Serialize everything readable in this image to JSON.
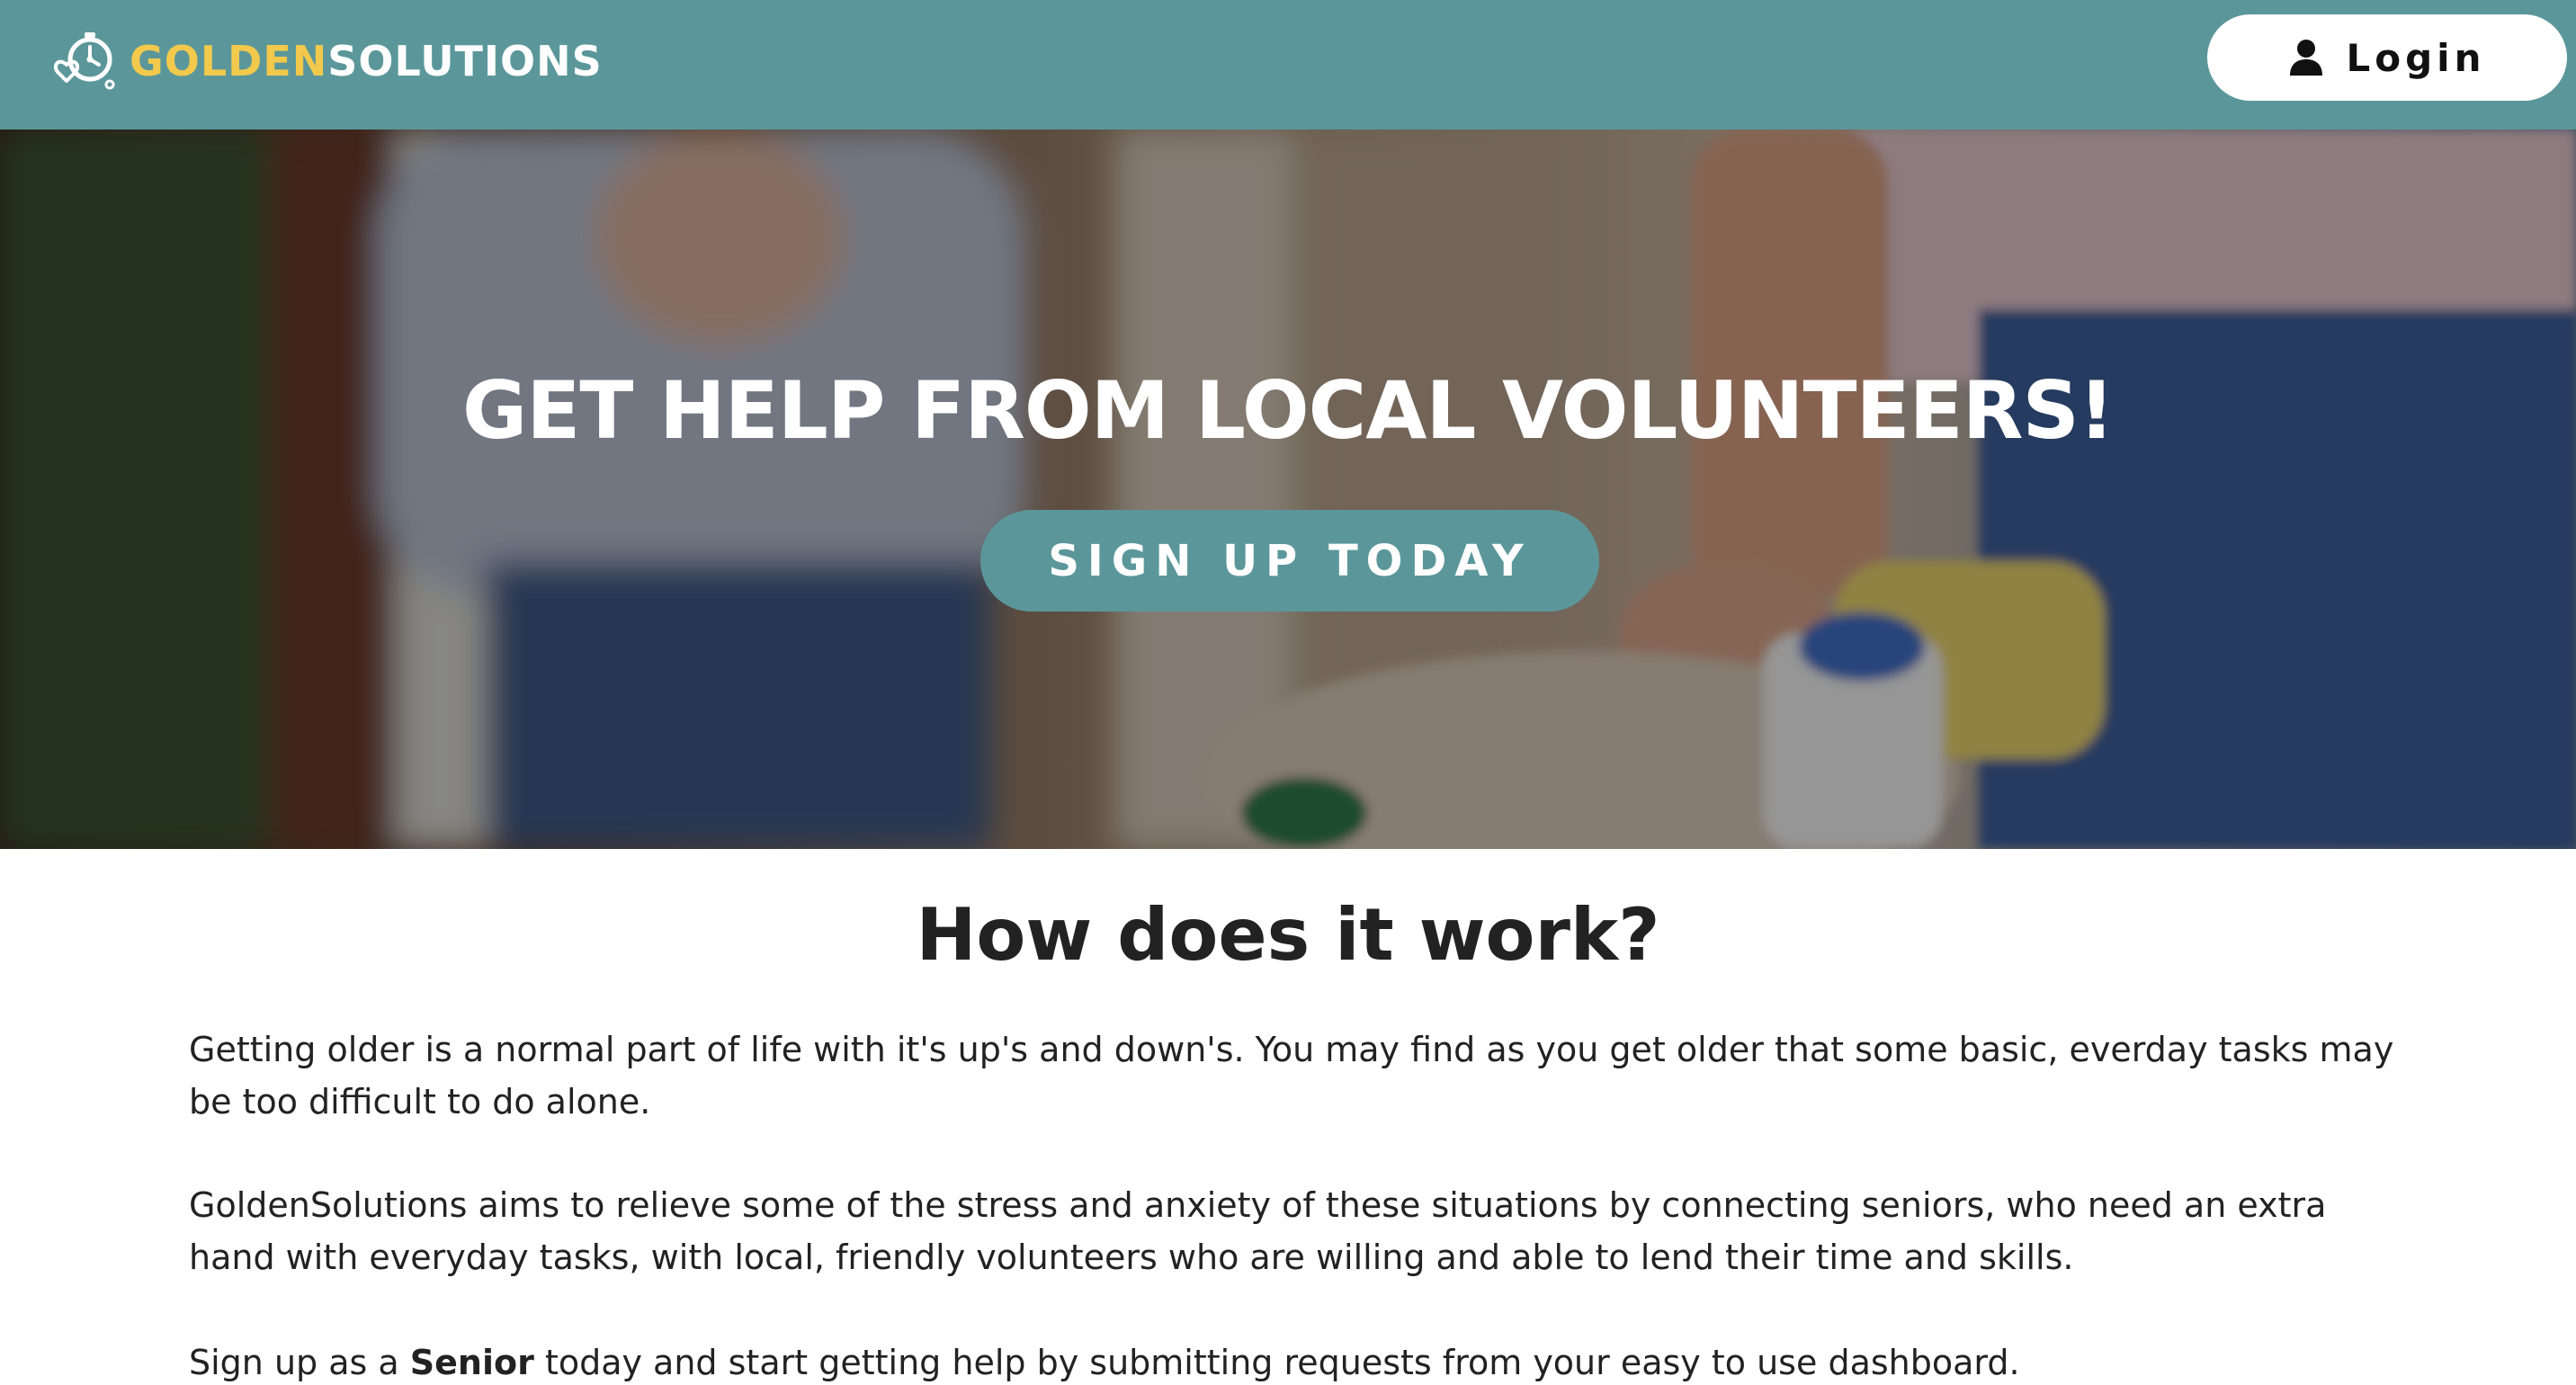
{
  "header": {
    "logo_golden": "GOLDEN",
    "logo_solutions": "SOLUTIONS",
    "logo_icon": "clock-heart-icon",
    "login_label": "Login",
    "login_icon": "user-icon",
    "brand_color": "#5b979a",
    "accent_color": "#f2c94c"
  },
  "hero": {
    "title": "GET HELP FROM LOCAL VOLUNTEERS!",
    "cta_label": "SIGN UP TODAY"
  },
  "how": {
    "title": "How does it work?",
    "paragraph1": "Getting older is a normal part of life with it's up's and down's. You may find as you get older that some basic, everday tasks may be too difficult to do alone.",
    "paragraph2": "GoldenSolutions aims to relieve some of the stress and anxiety of these situations by connecting seniors, who need an extra hand with everyday tasks, with local, friendly volunteers who are willing and able to lend their time and skills.",
    "paragraph3_pre": "Sign up as a ",
    "paragraph3_bold": "Senior",
    "paragraph3_post": " today and start getting help by submitting requests from your easy to use dashboard."
  }
}
